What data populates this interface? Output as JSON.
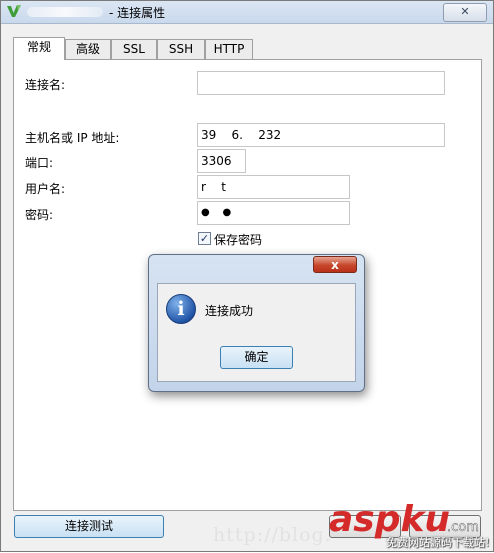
{
  "window": {
    "title": "- 连接属性",
    "close_glyph": "✕"
  },
  "tabs": [
    {
      "label": "常规",
      "active": true
    },
    {
      "label": "高级",
      "active": false
    },
    {
      "label": "SSL",
      "active": false
    },
    {
      "label": "SSH",
      "active": false
    },
    {
      "label": "HTTP",
      "active": false
    }
  ],
  "form": {
    "connection_name_label": "连接名:",
    "connection_name_value": "",
    "host_label": "主机名或 IP 地址:",
    "host_value": "39    6.    232",
    "port_label": "端口:",
    "port_value": "3306",
    "user_label": "用户名:",
    "user_value": "r    t",
    "password_label": "密码:",
    "password_value": "●    ●",
    "save_password_label": "保存密码",
    "save_password_checked": true
  },
  "footer": {
    "test_button": "连接测试"
  },
  "message_box": {
    "close_glyph": "x",
    "text": "连接成功",
    "ok_button": "确定",
    "icon": "info-icon"
  },
  "watermark": {
    "url": "http://blog.",
    "logo": "aspku",
    "logo_tld": ".com",
    "subtitle": "免费网站源码下载站!"
  },
  "colors": {
    "accent": "#3c7fb1",
    "logo_red": "#d42a2a",
    "close_red": "#c7472b"
  }
}
